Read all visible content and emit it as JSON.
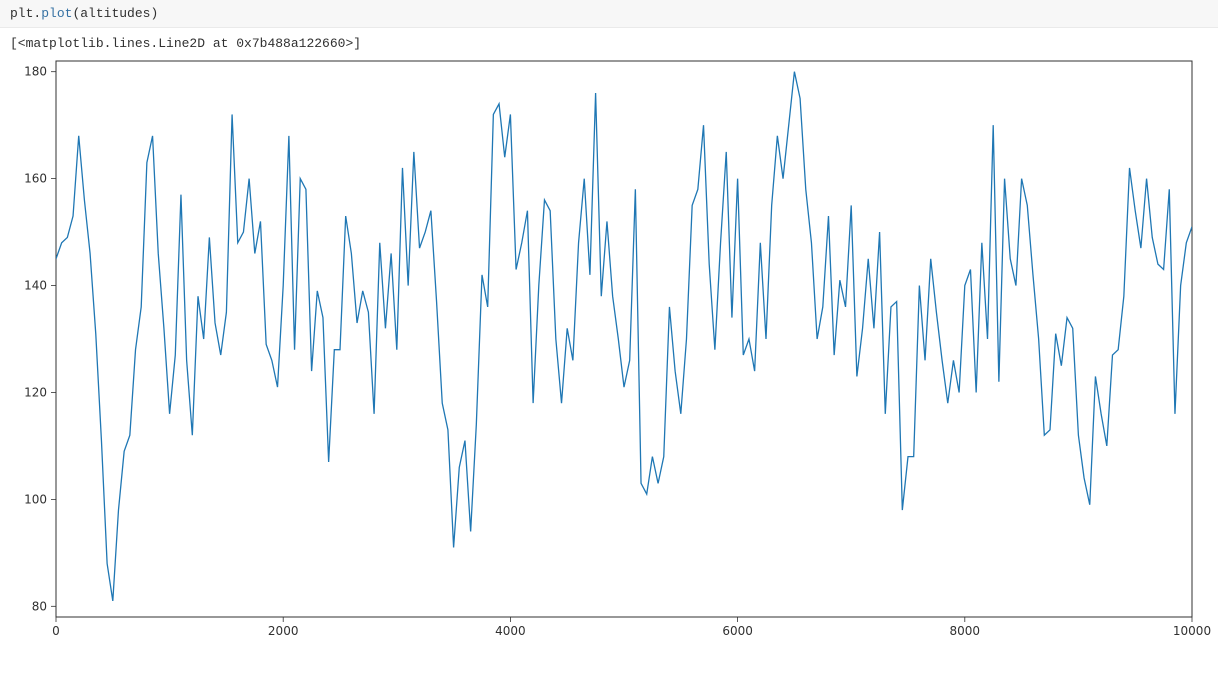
{
  "code_cell": {
    "obj": "plt.",
    "call": "plot",
    "paren_open": "(",
    "arg": "altitudes",
    "paren_close": ")"
  },
  "output_text": "[<matplotlib.lines.Line2D at 0x7b488a122660>]",
  "chart_data": {
    "type": "line",
    "xlabel": "",
    "ylabel": "",
    "title": "",
    "xlim": [
      0,
      10000
    ],
    "ylim": [
      78,
      182
    ],
    "xticks": [
      0,
      2000,
      4000,
      6000,
      8000,
      10000
    ],
    "yticks": [
      80,
      100,
      120,
      140,
      160,
      180
    ],
    "series": [
      {
        "name": "altitudes",
        "color": "#1f77b4",
        "x_step": 50,
        "y": [
          145,
          148,
          149,
          153,
          168,
          156,
          146,
          131,
          111,
          88,
          81,
          98,
          109,
          112,
          128,
          136,
          163,
          168,
          146,
          132,
          116,
          127,
          157,
          126,
          112,
          138,
          130,
          149,
          133,
          127,
          135,
          172,
          148,
          150,
          160,
          146,
          152,
          129,
          126,
          121,
          140,
          168,
          128,
          160,
          158,
          124,
          139,
          134,
          107,
          128,
          128,
          153,
          146,
          133,
          139,
          135,
          116,
          148,
          132,
          146,
          128,
          162,
          140,
          165,
          147,
          150,
          154,
          137,
          118,
          113,
          91,
          106,
          111,
          94,
          114,
          142,
          136,
          172,
          174,
          164,
          172,
          143,
          148,
          154,
          118,
          140,
          156,
          154,
          130,
          118,
          132,
          126,
          148,
          160,
          142,
          176,
          138,
          152,
          138,
          130,
          121,
          126,
          158,
          103,
          101,
          108,
          103,
          108,
          136,
          124,
          116,
          130,
          155,
          158,
          170,
          144,
          128,
          148,
          165,
          134,
          160,
          127,
          130,
          124,
          148,
          130,
          155,
          168,
          160,
          170,
          180,
          175,
          158,
          148,
          130,
          136,
          153,
          127,
          141,
          136,
          155,
          123,
          132,
          145,
          132,
          150,
          116,
          136,
          137,
          98,
          108,
          108,
          140,
          126,
          145,
          135,
          126,
          118,
          126,
          120,
          140,
          143,
          120,
          148,
          130,
          170,
          122,
          160,
          145,
          140,
          160,
          155,
          142,
          130,
          112,
          113,
          131,
          125,
          134,
          132,
          112,
          104,
          99,
          123,
          116,
          110,
          127,
          128,
          138,
          162,
          154,
          147,
          160,
          149,
          144,
          143,
          158,
          116,
          140,
          148,
          151
        ]
      }
    ]
  }
}
